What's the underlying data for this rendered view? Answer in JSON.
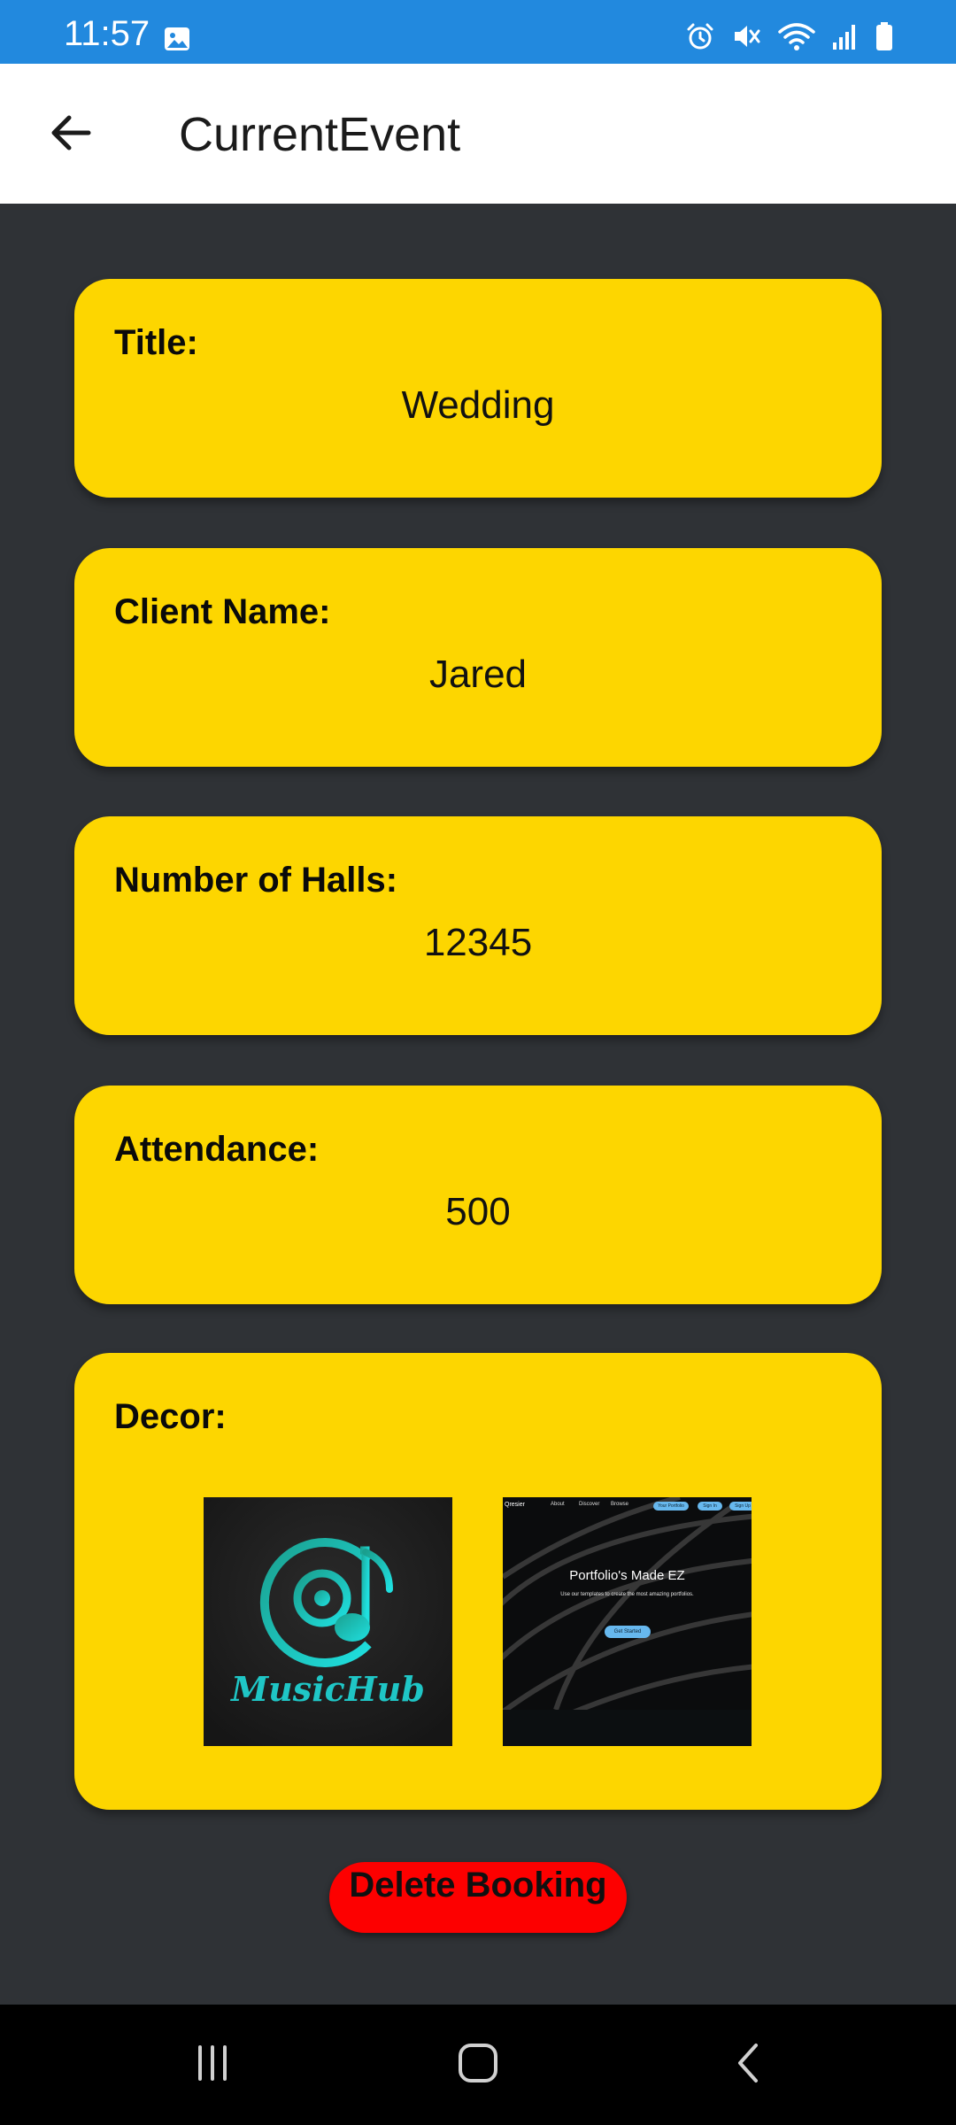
{
  "status_bar": {
    "time": "11:57",
    "background_color": "#2289de",
    "icons": [
      "image-icon",
      "alarm-icon",
      "mute-icon",
      "wifi-icon",
      "signal-icon",
      "battery-icon"
    ]
  },
  "app_bar": {
    "title": "CurrentEvent",
    "back_icon": "arrow-left-icon"
  },
  "cards": [
    {
      "label": "Title:",
      "value": "Wedding"
    },
    {
      "label": "Client Name:",
      "value": "Jared"
    },
    {
      "label": "Number of Halls:",
      "value": "12345"
    },
    {
      "label": "Attendance:",
      "value": "500"
    }
  ],
  "decor": {
    "label": "Decor:",
    "images": [
      {
        "name": "musichub-logo",
        "logo_text": "MusicHub"
      },
      {
        "name": "portfolio-screenshot",
        "nav_brand": "Qresier",
        "nav_links": [
          "About",
          "Discover",
          "Browse"
        ],
        "nav_buttons": [
          "Your Portfolio",
          "Sign In",
          "Sign Up"
        ],
        "headline": "Portfolio's Made EZ",
        "subtext": "Use our templates to create the most amazing portfolios.",
        "cta": "Get Started"
      }
    ]
  },
  "delete_button": {
    "label": "Delete Booking"
  },
  "colors": {
    "card": "#fdd600",
    "page_background": "#2f3236",
    "delete": "#fd0000",
    "logo_teal": "#1fc6c6"
  },
  "nav_bar": {
    "buttons": [
      "recent-apps-icon",
      "home-icon",
      "back-icon"
    ]
  }
}
